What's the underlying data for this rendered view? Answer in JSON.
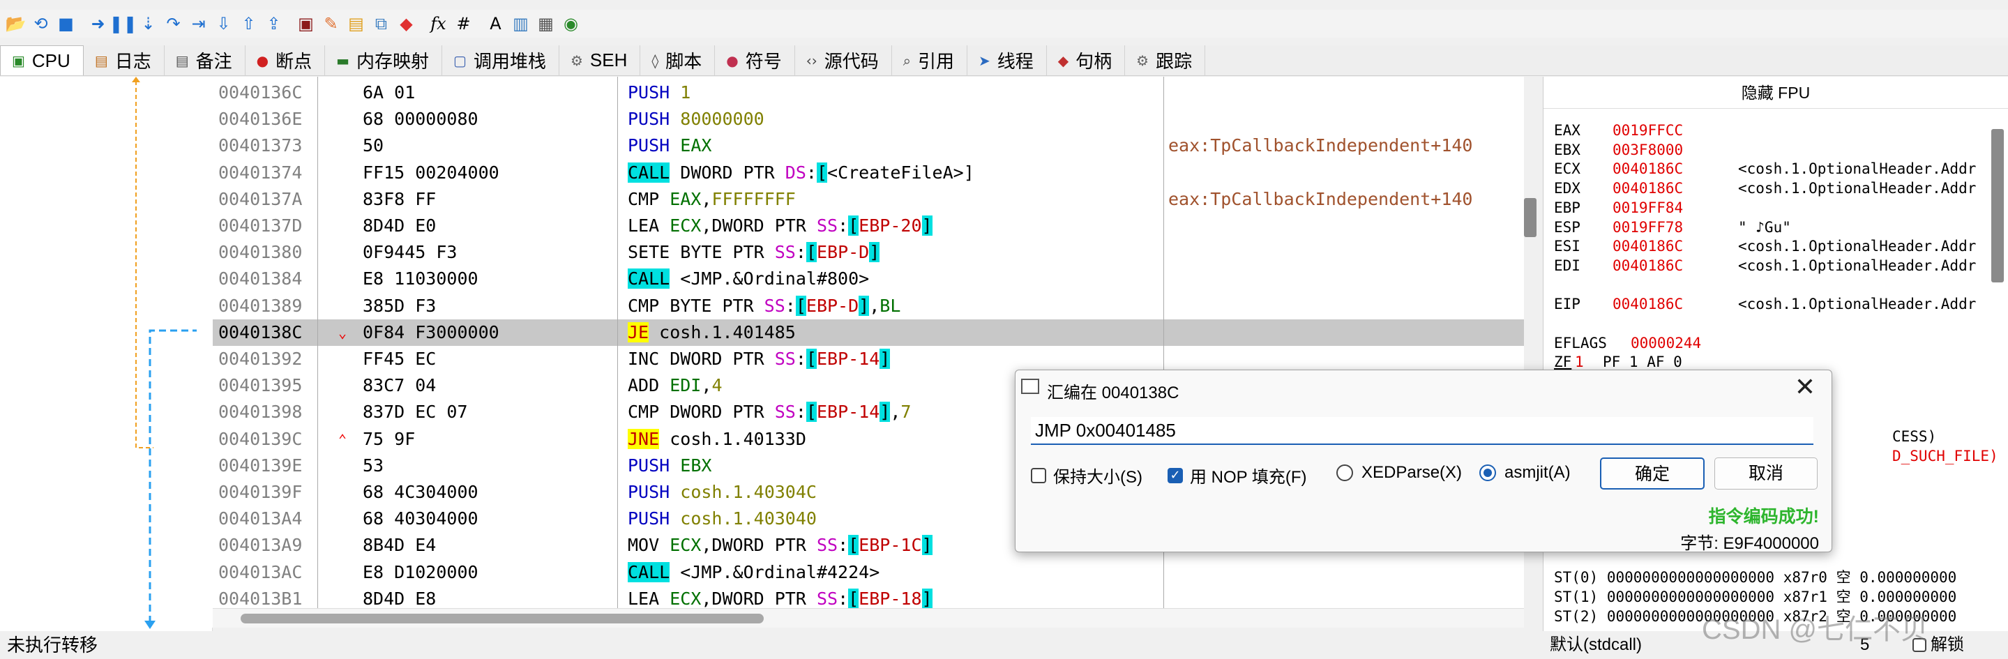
{
  "toolbar": {
    "buttons": [
      {
        "name": "open-icon",
        "glyph": "📂",
        "color": "#d4a020"
      },
      {
        "name": "restart-icon",
        "glyph": "⟲",
        "color": "#1e6fd0"
      },
      {
        "name": "stop-icon",
        "glyph": "■",
        "color": "#1e6fd0"
      },
      {
        "name": "run-icon",
        "glyph": "➜",
        "color": "#1e6fd0"
      },
      {
        "name": "pause-icon",
        "glyph": "❚❚",
        "color": "#1e6fd0"
      },
      {
        "name": "step-into-icon",
        "glyph": "⇣",
        "color": "#1e6fd0"
      },
      {
        "name": "step-over-icon",
        "glyph": "↷",
        "color": "#1e6fd0"
      },
      {
        "name": "trace-into-icon",
        "glyph": "⇥",
        "color": "#1e6fd0"
      },
      {
        "name": "trace-over-icon",
        "glyph": "⇩",
        "color": "#1e6fd0"
      },
      {
        "name": "run-to-user-icon",
        "glyph": "⇧",
        "color": "#1e6fd0"
      },
      {
        "name": "execute-till-return-icon",
        "glyph": "⇪",
        "color": "#1e6fd0"
      },
      {
        "name": "scylla-icon",
        "glyph": "▣",
        "color": "#8b1a1a"
      },
      {
        "name": "patch-icon",
        "glyph": "✎",
        "color": "#e07030"
      },
      {
        "name": "comments-icon",
        "glyph": "▤",
        "color": "#e0a020"
      },
      {
        "name": "labels-icon",
        "glyph": "⧉",
        "color": "#3a7dc0"
      },
      {
        "name": "bookmark-icon",
        "glyph": "◆",
        "color": "#e03030"
      },
      {
        "name": "function-icon",
        "glyph": "fx",
        "color": "#000000"
      },
      {
        "name": "hash-icon",
        "glyph": "#",
        "color": "#000000"
      },
      {
        "name": "font-icon",
        "glyph": "A",
        "color": "#000000"
      },
      {
        "name": "script-icon",
        "glyph": "▥",
        "color": "#3a7dc0"
      },
      {
        "name": "calculator-icon",
        "glyph": "▦",
        "color": "#555555"
      },
      {
        "name": "globe-icon",
        "glyph": "◉",
        "color": "#2a8a2a"
      }
    ]
  },
  "tabs": [
    {
      "label": "CPU",
      "icon": "cpu-icon",
      "glyph": "▣",
      "color": "#2a8a2a",
      "active": true
    },
    {
      "label": "日志",
      "icon": "log-icon",
      "glyph": "▤",
      "color": "#c07020"
    },
    {
      "label": "备注",
      "icon": "notes-icon",
      "glyph": "▤",
      "color": "#555"
    },
    {
      "label": "断点",
      "icon": "breakpoint-icon",
      "glyph": "●",
      "color": "#d02020"
    },
    {
      "label": "内存映射",
      "icon": "memory-map-icon",
      "glyph": "▬",
      "color": "#2a7a2a"
    },
    {
      "label": "调用堆栈",
      "icon": "call-stack-icon",
      "glyph": "▢",
      "color": "#3a60b0"
    },
    {
      "label": "SEH",
      "icon": "seh-icon",
      "glyph": "⚙",
      "color": "#666"
    },
    {
      "label": "脚本",
      "icon": "script-tab-icon",
      "glyph": "◊",
      "color": "#444"
    },
    {
      "label": "符号",
      "icon": "symbols-icon",
      "glyph": "●",
      "color": "#c03050"
    },
    {
      "label": "源代码",
      "icon": "source-icon",
      "glyph": "‹›",
      "color": "#444"
    },
    {
      "label": "引用",
      "icon": "references-icon",
      "glyph": "⌕",
      "color": "#444"
    },
    {
      "label": "线程",
      "icon": "threads-icon",
      "glyph": "➤",
      "color": "#2a6ac0"
    },
    {
      "label": "句柄",
      "icon": "handles-icon",
      "glyph": "◆",
      "color": "#c03030"
    },
    {
      "label": "跟踪",
      "icon": "trace-icon",
      "glyph": "⚙",
      "color": "#666"
    }
  ],
  "disasm": {
    "rows": [
      {
        "addr": "0040136C",
        "bytes": "6A 01",
        "mn": "PUSH",
        "mnStyle": "blue",
        "ops": [
          [
            "num",
            "1"
          ]
        ],
        "cmt": ""
      },
      {
        "addr": "0040136E",
        "bytes": "68 00000080",
        "mn": "PUSH",
        "mnStyle": "blue",
        "ops": [
          [
            "num",
            "80000000"
          ]
        ],
        "cmt": ""
      },
      {
        "addr": "00401373",
        "bytes": "50",
        "mn": "PUSH",
        "mnStyle": "blue",
        "ops": [
          [
            "reg",
            "EAX"
          ]
        ],
        "cmt": "eax:TpCallbackIndependent+140"
      },
      {
        "addr": "00401374",
        "bytes": "FF15 00204000",
        "mn": "CALL",
        "mnStyle": "call",
        "ops": [
          [
            "kw",
            " DWORD PTR "
          ],
          [
            "seg",
            "DS"
          ],
          [
            "kw",
            ":"
          ],
          [
            "brk",
            "["
          ],
          [
            "tgt",
            "<CreateFileA>"
          ],
          [
            "kw",
            "]"
          ]
        ],
        "cmt": ""
      },
      {
        "addr": "0040137A",
        "bytes": "83F8 FF",
        "mn": "CMP",
        "mnStyle": "",
        "ops": [
          [
            "reg",
            " EAX"
          ],
          [
            "kw",
            ","
          ],
          [
            "num",
            "FFFFFFFF"
          ]
        ],
        "cmt": "eax:TpCallbackIndependent+140"
      },
      {
        "addr": "0040137D",
        "bytes": "8D4D E0",
        "mn": "LEA",
        "mnStyle": "",
        "ops": [
          [
            "reg",
            " ECX"
          ],
          [
            "kw",
            ",DWORD PTR "
          ],
          [
            "seg",
            "SS"
          ],
          [
            "kw",
            ":"
          ],
          [
            "brk",
            "["
          ],
          [
            "mem",
            "EBP-20"
          ],
          [
            "brk",
            "]"
          ]
        ],
        "cmt": ""
      },
      {
        "addr": "00401380",
        "bytes": "0F9445 F3",
        "mn": "SETE",
        "mnStyle": "",
        "ops": [
          [
            "kw",
            " BYTE PTR "
          ],
          [
            "seg",
            "SS"
          ],
          [
            "kw",
            ":"
          ],
          [
            "brk",
            "["
          ],
          [
            "mem",
            "EBP-D"
          ],
          [
            "brk",
            "]"
          ]
        ],
        "cmt": ""
      },
      {
        "addr": "00401384",
        "bytes": "E8 11030000",
        "mn": "CALL",
        "mnStyle": "call",
        "ops": [
          [
            "kw",
            " "
          ],
          [
            "tgt",
            "<JMP.&Ordinal#800>"
          ]
        ],
        "cmt": ""
      },
      {
        "addr": "00401389",
        "bytes": "385D F3",
        "mn": "CMP",
        "mnStyle": "",
        "ops": [
          [
            "kw",
            " BYTE PTR "
          ],
          [
            "seg",
            "SS"
          ],
          [
            "kw",
            ":"
          ],
          [
            "brk",
            "["
          ],
          [
            "mem",
            "EBP-D"
          ],
          [
            "brk",
            "]"
          ],
          [
            "kw",
            ","
          ],
          [
            "reg",
            "BL"
          ]
        ],
        "cmt": ""
      },
      {
        "addr": "0040138C",
        "bytes": "0F84 F3000000",
        "mn": "JE",
        "mnStyle": "jmp",
        "mark": "⌄",
        "sel": true,
        "ops": [
          [
            "kw",
            " "
          ],
          [
            "tgt",
            "cosh.1.401485"
          ]
        ],
        "cmt": ""
      },
      {
        "addr": "00401392",
        "bytes": "FF45 EC",
        "mn": "INC",
        "mnStyle": "",
        "ops": [
          [
            "kw",
            " DWORD PTR "
          ],
          [
            "seg",
            "SS"
          ],
          [
            "kw",
            ":"
          ],
          [
            "brk",
            "["
          ],
          [
            "mem",
            "EBP-14"
          ],
          [
            "brk",
            "]"
          ]
        ],
        "cmt": ""
      },
      {
        "addr": "00401395",
        "bytes": "83C7 04",
        "mn": "ADD",
        "mnStyle": "",
        "ops": [
          [
            "reg",
            " EDI"
          ],
          [
            "kw",
            ","
          ],
          [
            "num",
            "4"
          ]
        ],
        "cmt": ""
      },
      {
        "addr": "00401398",
        "bytes": "837D EC 07",
        "mn": "CMP",
        "mnStyle": "",
        "ops": [
          [
            "kw",
            " DWORD PTR "
          ],
          [
            "seg",
            "SS"
          ],
          [
            "kw",
            ":"
          ],
          [
            "brk",
            "["
          ],
          [
            "mem",
            "EBP-14"
          ],
          [
            "brk",
            "]"
          ],
          [
            "kw",
            ","
          ],
          [
            "num",
            "7"
          ]
        ],
        "cmt": ""
      },
      {
        "addr": "0040139C",
        "bytes": "75 9F",
        "mn": "JNE",
        "mnStyle": "jmp",
        "mark": "⌃",
        "ops": [
          [
            "kw",
            " "
          ],
          [
            "tgt",
            "cosh.1.40133D"
          ]
        ],
        "cmt": ""
      },
      {
        "addr": "0040139E",
        "bytes": "53",
        "mn": "PUSH",
        "mnStyle": "blue",
        "ops": [
          [
            "reg",
            "EBX"
          ]
        ],
        "cmt": ""
      },
      {
        "addr": "0040139F",
        "bytes": "68 4C304000",
        "mn": "PUSH",
        "mnStyle": "blue",
        "ops": [
          [
            "num",
            "cosh.1.40304C"
          ]
        ],
        "cmt": ""
      },
      {
        "addr": "004013A4",
        "bytes": "68 40304000",
        "mn": "PUSH",
        "mnStyle": "blue",
        "ops": [
          [
            "num",
            "cosh.1.403040"
          ]
        ],
        "cmt": ""
      },
      {
        "addr": "004013A9",
        "bytes": "8B4D E4",
        "mn": "MOV",
        "mnStyle": "",
        "ops": [
          [
            "reg",
            " ECX"
          ],
          [
            "kw",
            ",DWORD PTR "
          ],
          [
            "seg",
            "SS"
          ],
          [
            "kw",
            ":"
          ],
          [
            "brk",
            "["
          ],
          [
            "mem",
            "EBP-1C"
          ],
          [
            "brk",
            "]"
          ]
        ],
        "cmt": ""
      },
      {
        "addr": "004013AC",
        "bytes": "E8 D1020000",
        "mn": "CALL",
        "mnStyle": "call",
        "ops": [
          [
            "kw",
            " "
          ],
          [
            "tgt",
            "<JMP.&Ordinal#4224>"
          ]
        ],
        "cmt": ""
      },
      {
        "addr": "004013B1",
        "bytes": "8D4D E8",
        "mn": "LEA",
        "mnStyle": "",
        "ops": [
          [
            "reg",
            " ECX"
          ],
          [
            "kw",
            ",DWORD PTR "
          ],
          [
            "seg",
            "SS"
          ],
          [
            "kw",
            ":"
          ],
          [
            "brk",
            "["
          ],
          [
            "mem",
            "EBP-18"
          ],
          [
            "brk",
            "]"
          ]
        ],
        "cmt": ""
      }
    ]
  },
  "status": {
    "text": "未执行转移"
  },
  "regs": {
    "header": "隐藏 FPU",
    "list": [
      {
        "n": "EAX",
        "v": "0019FFCC",
        "c": ""
      },
      {
        "n": "EBX",
        "v": "003F8000",
        "c": ""
      },
      {
        "n": "ECX",
        "v": "0040186C",
        "c": "<cosh.1.OptionalHeader.Addr"
      },
      {
        "n": "EDX",
        "v": "0040186C",
        "c": "<cosh.1.OptionalHeader.Addr"
      },
      {
        "n": "EBP",
        "v": "0019FF84",
        "c": ""
      },
      {
        "n": "ESP",
        "v": "0019FF78",
        "c": "\" ♪Gu\""
      },
      {
        "n": "ESI",
        "v": "0040186C",
        "c": "<cosh.1.OptionalHeader.Addr"
      },
      {
        "n": "EDI",
        "v": "0040186C",
        "c": "<cosh.1.OptionalHeader.Addr"
      },
      {
        "n": "",
        "v": "",
        "c": ""
      },
      {
        "n": "EIP",
        "v": "0040186C",
        "c": "<cosh.1.OptionalHeader.Addr"
      },
      {
        "n": "",
        "v": "",
        "c": ""
      },
      {
        "n": "EFLAGS",
        "v": "00000244",
        "c": ""
      },
      {
        "n": "ZF",
        "v": "1",
        "c": "PF 1  AF 0"
      }
    ],
    "tail1": "CESS)",
    "tail2": "D_SUCH_FILE)",
    "fpu": [
      "ST(0) 0000000000000000000 x87r0 空 0.000000000",
      "ST(1) 0000000000000000000 x87r1 空 0.000000000",
      "ST(2) 0000000000000000000 x87r2 空 0.000000000"
    ]
  },
  "bottom": {
    "callconv": "默认(stdcall)",
    "argcount": "5",
    "unlock": "解锁"
  },
  "dialog": {
    "title": "汇编在 0040138C",
    "input": "JMP 0x00401485",
    "keepSize": "保持大小(S)",
    "fillNop": "用 NOP 填充(F)",
    "xedparse": "XEDParse(X)",
    "asmjit": "asmjit(A)",
    "ok": "确定",
    "cancel": "取消",
    "success": "指令编码成功!",
    "bytes": "字节: E9F4000000",
    "keepSizeChecked": false,
    "fillNopChecked": true
  },
  "watermark": "CSDN @七仁不贝"
}
